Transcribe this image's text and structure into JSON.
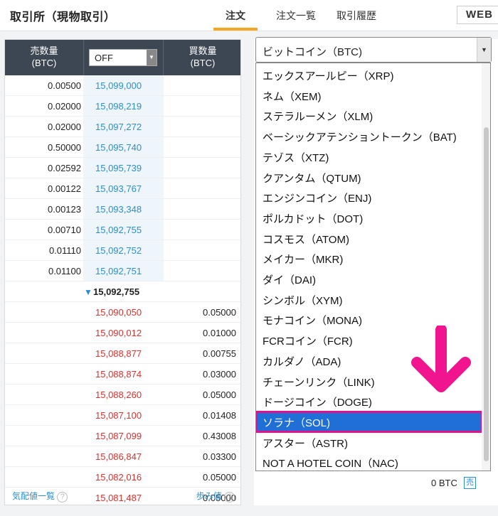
{
  "header": {
    "title": "取引所（現物取引）",
    "tabs": [
      "注文",
      "注文一覧",
      "取引履歴"
    ],
    "logo_text": "WEB"
  },
  "book": {
    "sell_header_1": "売数量",
    "sell_header_2": "(BTC)",
    "buy_header_1": "買数量",
    "buy_header_2": "(BTC)",
    "filter_value": "OFF",
    "asks": [
      {
        "qty": "0.00500",
        "price": "15,099,000"
      },
      {
        "qty": "0.02000",
        "price": "15,098,219"
      },
      {
        "qty": "0.02000",
        "price": "15,097,272"
      },
      {
        "qty": "0.50000",
        "price": "15,095,740"
      },
      {
        "qty": "0.02592",
        "price": "15,095,739"
      },
      {
        "qty": "0.00122",
        "price": "15,093,767"
      },
      {
        "qty": "0.00123",
        "price": "15,093,348"
      },
      {
        "qty": "0.00710",
        "price": "15,092,755"
      },
      {
        "qty": "0.01110",
        "price": "15,092,752"
      },
      {
        "qty": "0.01100",
        "price": "15,092,751"
      }
    ],
    "last_price": "15,092,755",
    "bids": [
      {
        "price": "15,090,050",
        "qty": "0.05000"
      },
      {
        "price": "15,090,012",
        "qty": "0.01000"
      },
      {
        "price": "15,088,877",
        "qty": "0.00755"
      },
      {
        "price": "15,088,874",
        "qty": "0.03000"
      },
      {
        "price": "15,088,260",
        "qty": "0.05000"
      },
      {
        "price": "15,087,100",
        "qty": "0.01408"
      },
      {
        "price": "15,087,099",
        "qty": "0.43008"
      },
      {
        "price": "15,086,847",
        "qty": "0.03300"
      },
      {
        "price": "15,082,016",
        "qty": "0.05000"
      },
      {
        "price": "15,081,487",
        "qty": "0.05000"
      }
    ],
    "footer_left": "気配値一覧",
    "footer_right": "歩み値",
    "help_glyph": "?"
  },
  "coin_select": {
    "value": "ビットコイン（BTC)",
    "options": [
      "エックスアールピー（XRP)",
      "ネム（XEM)",
      "ステラルーメン（XLM)",
      "ベーシックアテンショントークン（BAT)",
      "テゾス（XTZ)",
      "クアンタム（QTUM)",
      "エンジンコイン（ENJ)",
      "ポルカドット（DOT)",
      "コスモス（ATOM)",
      "メイカー（MKR)",
      "ダイ（DAI)",
      "シンボル（XYM)",
      "モナコイン（MONA)",
      "FCRコイン（FCR)",
      "カルダノ（ADA)",
      "チェーンリンク（LINK)",
      "ドージコイン（DOGE)",
      "ソラナ（SOL)",
      "アスター（ASTR)",
      "NOT A HOTEL COIN（NAC)"
    ],
    "selected_index": 17
  },
  "balance": {
    "btc_text": "0 BTC",
    "sell_badge": "売"
  },
  "colors": {
    "highlight": "#1f6fd6",
    "annotation_pink": "#e0118a",
    "tab_accent": "#f5a623"
  }
}
